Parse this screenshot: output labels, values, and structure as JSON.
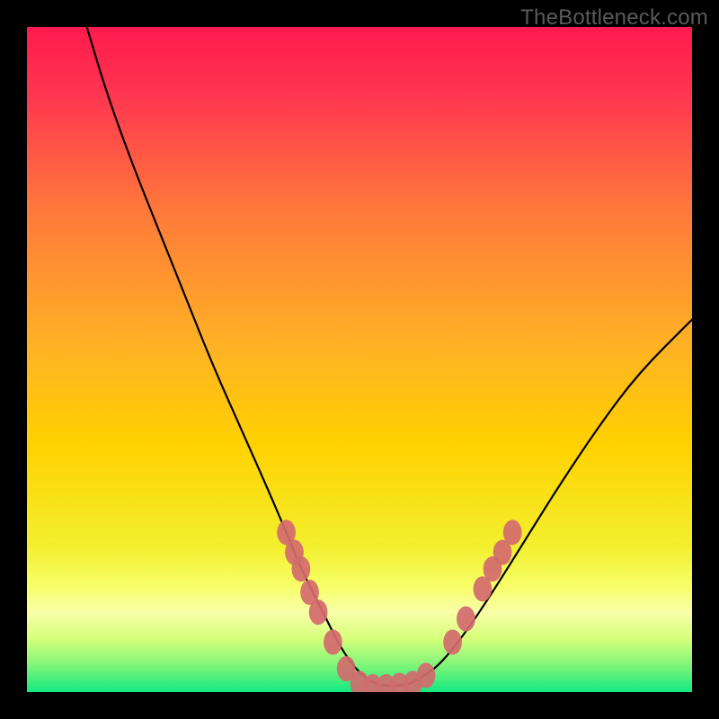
{
  "watermark": "TheBottleneck.com",
  "chart_data": {
    "type": "line",
    "title": "",
    "xlabel": "",
    "ylabel": "",
    "xlim": [
      0,
      100
    ],
    "ylim": [
      0,
      100
    ],
    "grid": false,
    "legend": false,
    "background_gradient": {
      "top": "#ff1a4d",
      "mid": "#ffd200",
      "bottom": "#12e880"
    },
    "series": [
      {
        "name": "curve",
        "color": "#000000",
        "x": [
          9,
          12,
          16,
          20,
          24,
          28,
          32,
          36,
          39,
          41,
          43,
          45,
          47,
          49,
          51,
          53,
          55,
          57,
          59,
          62,
          66,
          70,
          75,
          80,
          86,
          92,
          100
        ],
        "y": [
          100,
          90,
          79,
          69,
          59,
          49,
          40,
          31,
          24,
          19,
          15,
          11,
          7,
          4,
          2,
          1,
          1,
          1,
          2,
          4,
          9,
          15,
          23,
          31,
          40,
          48,
          56
        ]
      }
    ],
    "markers": {
      "name": "beads",
      "color": "#d26a6e",
      "rx": 1.4,
      "ry": 1.9,
      "points": [
        {
          "x": 39.0,
          "y": 24.0
        },
        {
          "x": 40.2,
          "y": 21.0
        },
        {
          "x": 41.2,
          "y": 18.5
        },
        {
          "x": 42.5,
          "y": 15.0
        },
        {
          "x": 43.8,
          "y": 12.0
        },
        {
          "x": 46.0,
          "y": 7.5
        },
        {
          "x": 48.0,
          "y": 3.5
        },
        {
          "x": 50.0,
          "y": 1.3
        },
        {
          "x": 52.0,
          "y": 0.8
        },
        {
          "x": 54.0,
          "y": 0.8
        },
        {
          "x": 56.0,
          "y": 1.0
        },
        {
          "x": 58.0,
          "y": 1.3
        },
        {
          "x": 60.0,
          "y": 2.5
        },
        {
          "x": 64.0,
          "y": 7.5
        },
        {
          "x": 66.0,
          "y": 11.0
        },
        {
          "x": 68.5,
          "y": 15.5
        },
        {
          "x": 70.0,
          "y": 18.5
        },
        {
          "x": 71.5,
          "y": 21.0
        },
        {
          "x": 73.0,
          "y": 24.0
        }
      ]
    }
  }
}
